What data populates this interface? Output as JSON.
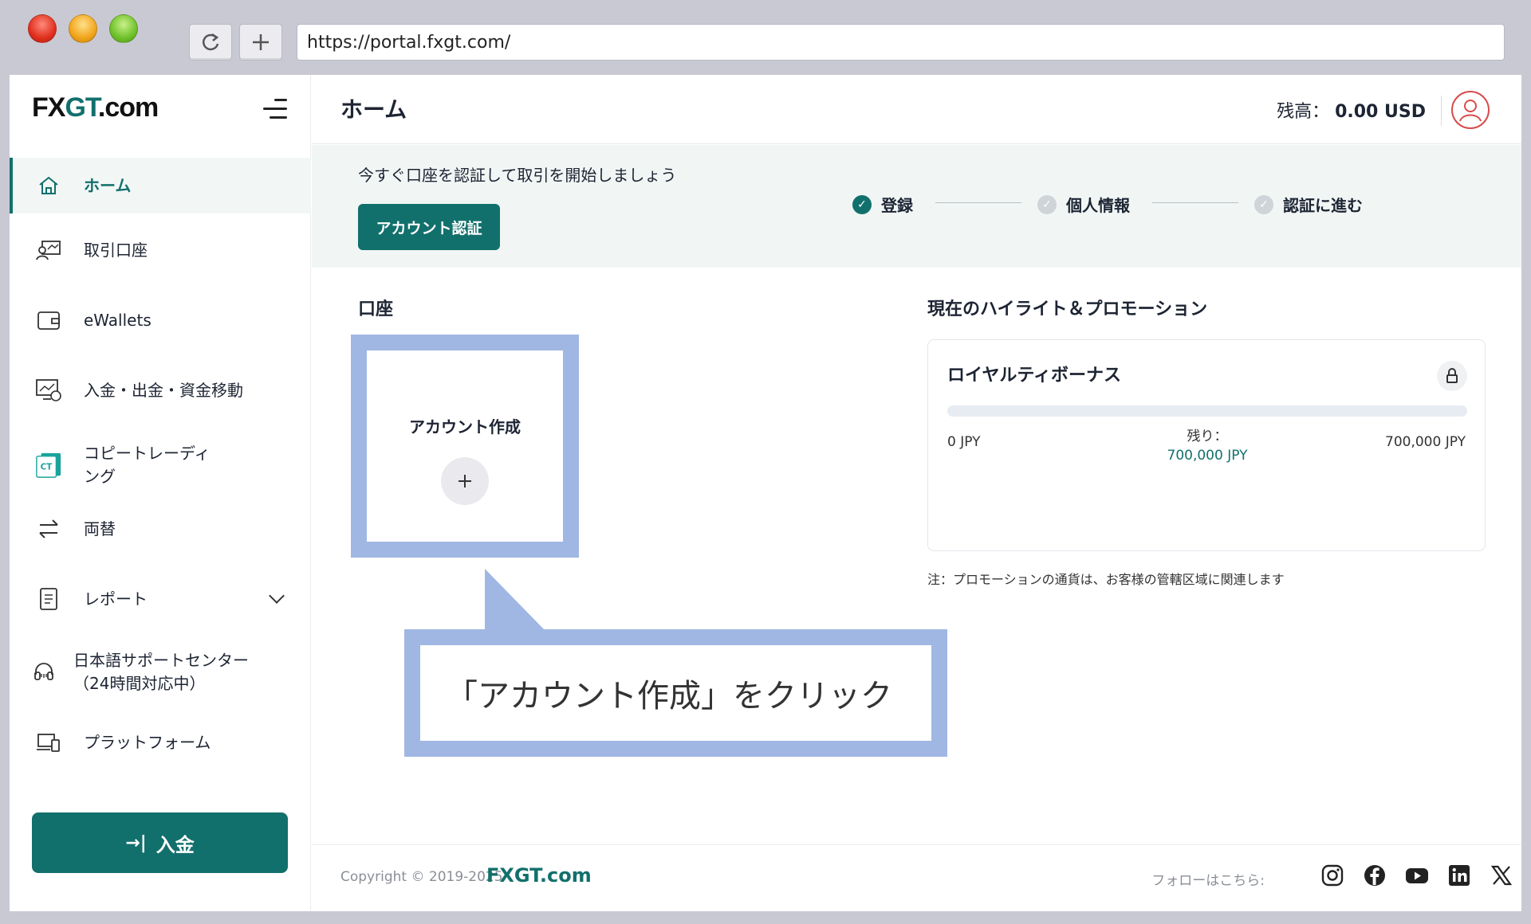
{
  "browser": {
    "url": "https://portal.fxgt.com/"
  },
  "logo": {
    "part1": "FX",
    "part2": "GT",
    "part3": ".com"
  },
  "sidebar": {
    "items": [
      {
        "label": "ホーム",
        "icon": "home-icon"
      },
      {
        "label": "取引口座",
        "icon": "trading-account-icon"
      },
      {
        "label": "eWallets",
        "icon": "wallet-icon"
      },
      {
        "label": "入金・出金・資金移動",
        "icon": "funds-icon"
      },
      {
        "label": "コピートレーディ",
        "label2": "ング",
        "icon": "copy-trading-icon"
      },
      {
        "label": "両替",
        "icon": "exchange-icon"
      },
      {
        "label": "レポート",
        "icon": "report-icon"
      },
      {
        "label": "日本語サポートセンター",
        "label2": "（24時間対応中）",
        "icon": "support-icon"
      },
      {
        "label": "プラットフォーム",
        "icon": "platform-icon"
      }
    ],
    "deposit_label": "入金"
  },
  "header": {
    "title": "ホーム",
    "balance_label": "残高：",
    "balance_value": "0.00 USD"
  },
  "banner": {
    "text": "今すぐ口座を認証して取引を開始しましょう",
    "verify_button": "アカウント認証",
    "steps": [
      "登録",
      "個人情報",
      "認証に進む"
    ]
  },
  "accounts": {
    "title": "口座",
    "create_label": "アカウント作成"
  },
  "callout": {
    "text": "「アカウント作成」をクリック"
  },
  "promotions": {
    "title": "現在のハイライト＆プロモーション",
    "card_title": "ロイヤルティボーナス",
    "min_label": "0 JPY",
    "max_label": "700,000 JPY",
    "remaining_label": "残り：",
    "remaining_value": "700,000 JPY",
    "progress_fraction": 0,
    "note": "注：プロモーションの通貨は、お客様の管轄区域に関連します"
  },
  "footer": {
    "copyright": "Copyright © 2019-2025",
    "brand": "FXGT.com",
    "follow": "フォローはこちら:",
    "socials": [
      "instagram-icon",
      "facebook-icon",
      "youtube-icon",
      "linkedin-icon",
      "x-icon"
    ]
  },
  "colors": {
    "accent": "#12706c",
    "highlight": "#a0b7e3"
  }
}
